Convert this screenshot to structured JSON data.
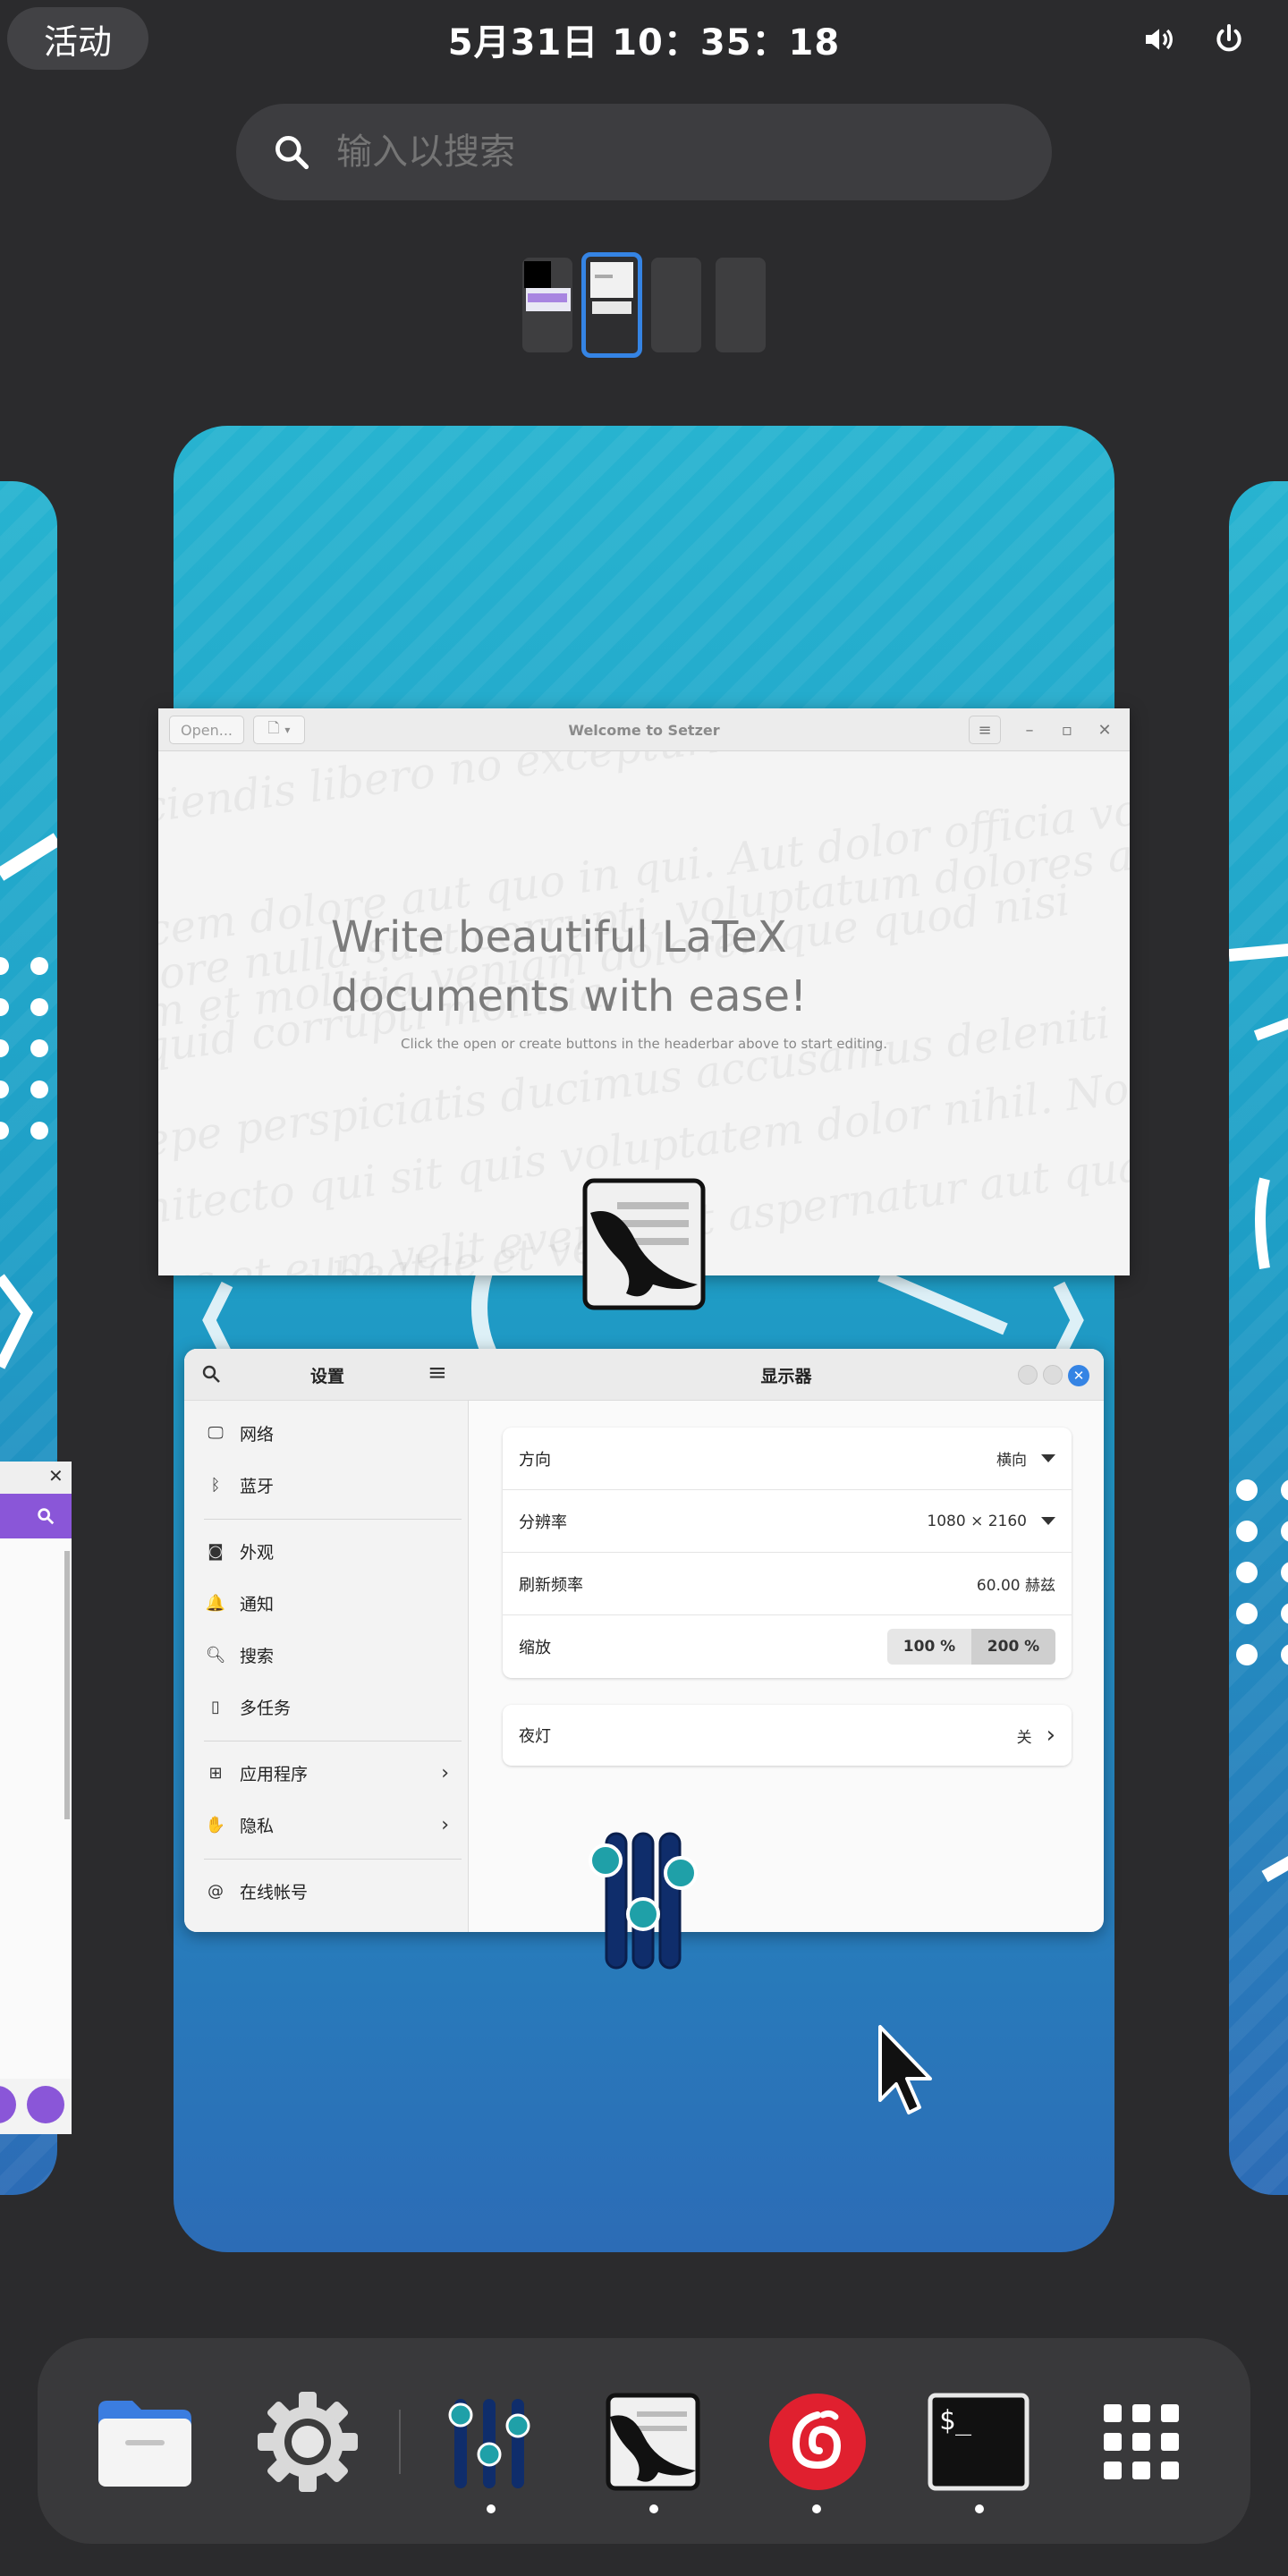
{
  "top_bar": {
    "activities": "活动",
    "clock": "5月31日 10：35：18",
    "volume_icon": "volume-icon",
    "power_icon": "power-icon"
  },
  "search": {
    "placeholder": "输入以搜索",
    "icon": "search-icon"
  },
  "workspaces": {
    "count": 4,
    "active_index": 1
  },
  "setzer_window": {
    "open_button": "Open...",
    "title": "Welcome to Setzer",
    "headline": "Write beautiful LaTeX documents with ease!",
    "subtext": "Click the open or create buttons in the headerbar above to start editing.",
    "background_lorem": [
      "ciendis libero no            excepturi ut                 ",
      "cem dolore aut quo in qui. Aut dolor officia     voluptatum dolore reprehender",
      "lore nulla sunt corrupti, voluptatum dolores aut quis molestia",
      "m et mollitia     veniam doloremque quod nisi",
      "quid corrupti                  mollitia.",
      "epe perspiciatis     ducimus accusamus deleniti",
      "hitecto qui sit quis voluptatem       dolor nihil. Non e",
      "rus et eum velit eveniet ut aspernatur aut quae aut. Qui et si",
      "       d autem       beatae et verita"
    ]
  },
  "settings_window": {
    "sidebar_title": "设置",
    "main_title": "显示器",
    "sidebar_items": [
      {
        "label": "网络",
        "icon": "monitor-network-icon"
      },
      {
        "label": "蓝牙",
        "icon": "bluetooth-icon"
      },
      {
        "label": "外观",
        "icon": "appearance-icon"
      },
      {
        "label": "通知",
        "icon": "bell-icon"
      },
      {
        "label": "搜索",
        "icon": "search-icon"
      },
      {
        "label": "多任务",
        "icon": "multitasking-icon"
      },
      {
        "label": "应用程序",
        "icon": "apps-grid-icon"
      },
      {
        "label": "隐私",
        "icon": "hand-icon"
      },
      {
        "label": "在线帐号",
        "icon": "at-icon"
      }
    ],
    "display_rows": [
      {
        "label": "方向",
        "value": "横向"
      },
      {
        "label": "分辨率",
        "value": "1080 × 2160"
      },
      {
        "label": "刷新频率",
        "value": "60.00 赫兹"
      },
      {
        "label": "缩放",
        "options": [
          "100 %",
          "200 %"
        ],
        "selected": "200 %"
      }
    ],
    "night_light": {
      "label": "夜灯",
      "value": "关"
    }
  },
  "dash": {
    "apps": [
      {
        "name": "Files",
        "icon": "files-icon",
        "running": false
      },
      {
        "name": "Settings",
        "icon": "settings-gear-icon",
        "running": false
      },
      {
        "name": "Mixer",
        "icon": "mixer-icon",
        "running": true
      },
      {
        "name": "Setzer",
        "icon": "setzer-icon",
        "running": true
      },
      {
        "name": "NetEase Cloud Music",
        "icon": "netease-music-icon",
        "running": true
      },
      {
        "name": "Terminal",
        "icon": "terminal-icon",
        "running": true
      },
      {
        "name": "Show Applications",
        "icon": "app-grid-icon",
        "running": false
      }
    ]
  },
  "colors": {
    "accent": "#3584e4",
    "panel_bg": "#2b2b2d",
    "wallpaper_top": "#27b3d0",
    "wallpaper_bottom": "#2c6cb6"
  }
}
